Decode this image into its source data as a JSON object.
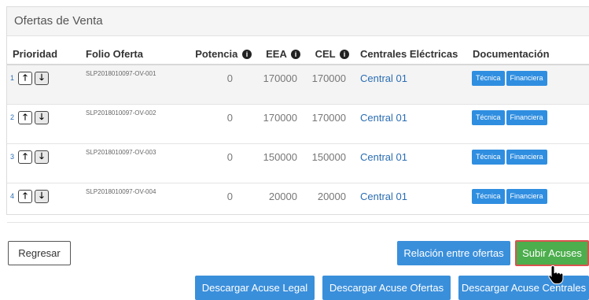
{
  "panel": {
    "title": "Ofertas de Venta"
  },
  "table": {
    "headers": {
      "prioridad": "Prioridad",
      "folio": "Folio Oferta",
      "potencia": "Potencia",
      "eea": "EEA",
      "cel": "CEL",
      "centrales": "Centrales Eléctricas",
      "documentacion": "Documentación"
    },
    "info_glyph": "i",
    "rows": [
      {
        "priority": "1",
        "folio": "SLP2018010097-OV-001",
        "potencia": "0",
        "eea": "170000",
        "cel": "170000",
        "central": "Central 01"
      },
      {
        "priority": "2",
        "folio": "SLP2018010097-OV-002",
        "potencia": "0",
        "eea": "170000",
        "cel": "170000",
        "central": "Central 01"
      },
      {
        "priority": "3",
        "folio": "SLP2018010097-OV-003",
        "potencia": "0",
        "eea": "150000",
        "cel": "150000",
        "central": "Central 01"
      },
      {
        "priority": "4",
        "folio": "SLP2018010097-OV-004",
        "potencia": "0",
        "eea": "20000",
        "cel": "20000",
        "central": "Central 01"
      }
    ],
    "arrow_up": "🡑",
    "arrow_down": "🡓",
    "doc_tecnica": "Técnica",
    "doc_financiera": "Financiera"
  },
  "actions": {
    "regresar": "Regresar",
    "relacion": "Relación entre ofertas",
    "subir": "Subir Acuses",
    "acuse_legal": "Descargar Acuse Legal",
    "acuse_ofertas": "Descargar Acuse Ofertas",
    "acuse_centrales": "Descargar Acuse Centrales"
  },
  "colors": {
    "primary": "#3a8fdb",
    "success": "#4cae4c",
    "link": "#2a6db3",
    "highlight_border": "#d9534f"
  }
}
